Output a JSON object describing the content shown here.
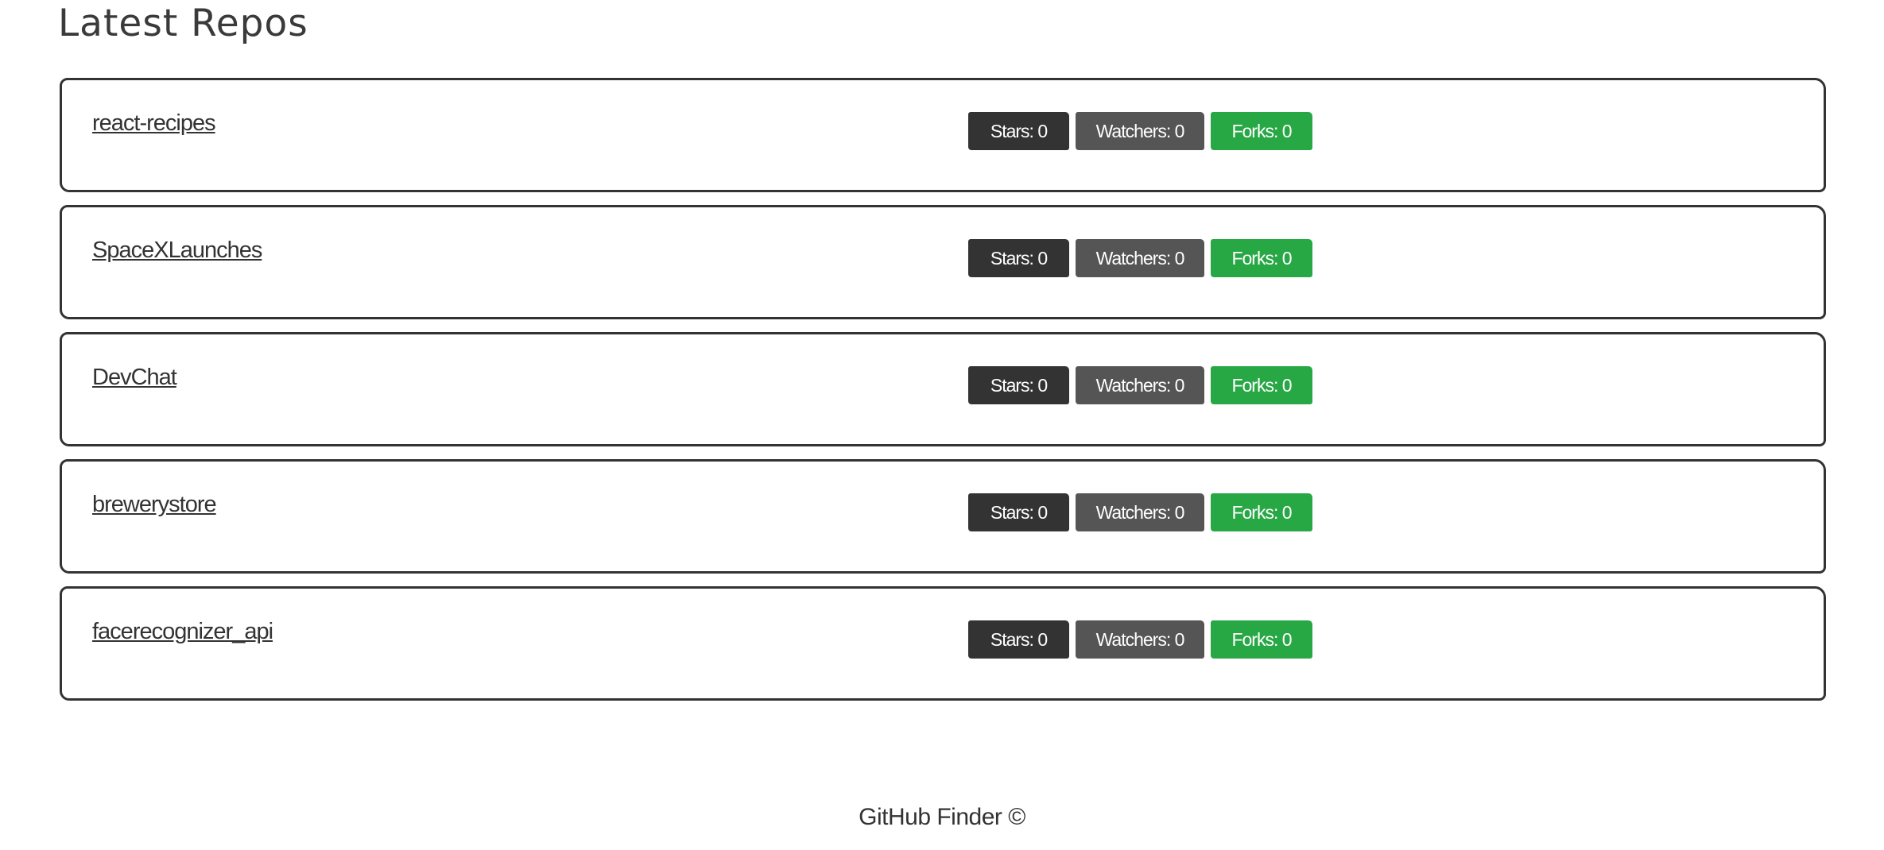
{
  "page": {
    "title": "Latest Repos"
  },
  "repos": [
    {
      "name": "react-recipes",
      "stars": "Stars: 0",
      "watchers": "Watchers: 0",
      "forks": "Forks: 0"
    },
    {
      "name": "SpaceXLaunches",
      "stars": "Stars: 0",
      "watchers": "Watchers: 0",
      "forks": "Forks: 0"
    },
    {
      "name": "DevChat",
      "stars": "Stars: 0",
      "watchers": "Watchers: 0",
      "forks": "Forks: 0"
    },
    {
      "name": "brewerystore",
      "stars": "Stars: 0",
      "watchers": "Watchers: 0",
      "forks": "Forks: 0"
    },
    {
      "name": "facerecognizer_api",
      "stars": "Stars: 0",
      "watchers": "Watchers: 0",
      "forks": "Forks: 0"
    }
  ],
  "footer": {
    "text": "GitHub Finder ©"
  },
  "colors": {
    "stars_badge": "#333333",
    "watchers_badge": "#555555",
    "forks_badge": "#28a745",
    "border": "#333333"
  }
}
